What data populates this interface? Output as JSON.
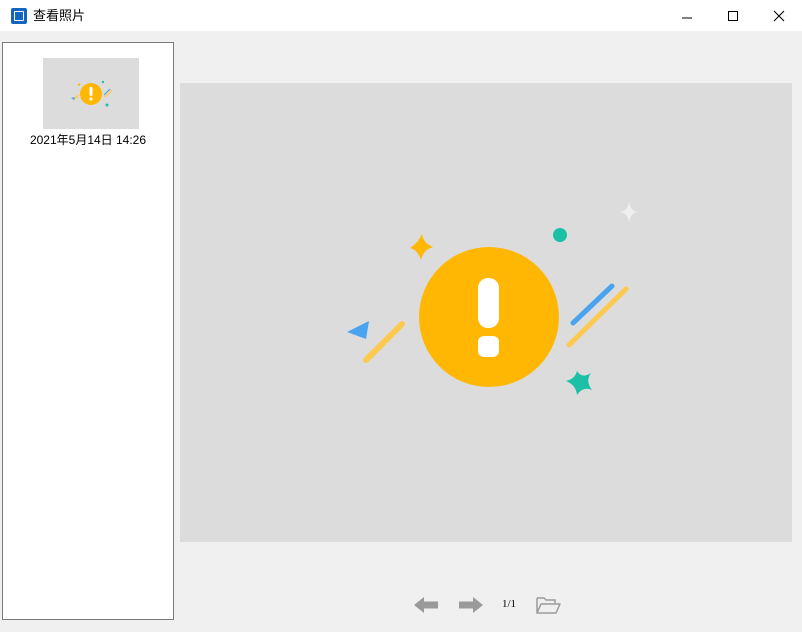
{
  "window": {
    "title": "查看照片",
    "icon": "photo-viewer-app-icon"
  },
  "titlebar_buttons": [
    "minimize-icon",
    "maximize-icon",
    "close-icon"
  ],
  "sidebar": {
    "items": [
      {
        "label": "2021年5月14日 14:26",
        "thumbnail": "warning-illustration"
      }
    ]
  },
  "viewer": {
    "image": "warning-illustration",
    "colors": {
      "background": "#dcdcdc",
      "circle": "#ffb703",
      "accent_blue": "#4aa3ef",
      "accent_teal": "#1cc0a6",
      "accent_yellow": "#ffc94d",
      "sparkle": "#efefef"
    }
  },
  "navigation": {
    "prev_icon": "left-arrow-icon",
    "next_icon": "right-arrow-icon",
    "page_indicator": "1/1",
    "folder_icon": "open-folder-icon"
  }
}
